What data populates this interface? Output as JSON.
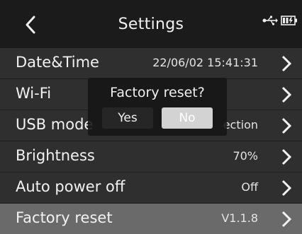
{
  "header": {
    "title": "Settings",
    "back_icon": "chevron-left-icon",
    "status_icons": [
      "usb-icon",
      "battery-charging-icon"
    ]
  },
  "rows": [
    {
      "label": "Date&Time",
      "value": "22/06/02 15:41:31"
    },
    {
      "label": "Wi-Fi",
      "value": ""
    },
    {
      "label": "USB mode",
      "value": "ection"
    },
    {
      "label": "Brightness",
      "value": "70%"
    },
    {
      "label": "Auto power off",
      "value": "Off"
    },
    {
      "label": "Factory reset",
      "value": "V1.1.8",
      "selected": true
    }
  ],
  "dialog": {
    "title": "Factory reset?",
    "yes_label": "Yes",
    "no_label": "No",
    "focused": "No"
  },
  "colors": {
    "background": "#1e1e1e",
    "row": "#2f2f2f",
    "selected_row": "#6a6a6a",
    "dialog_focus": "#d3d3d3"
  }
}
